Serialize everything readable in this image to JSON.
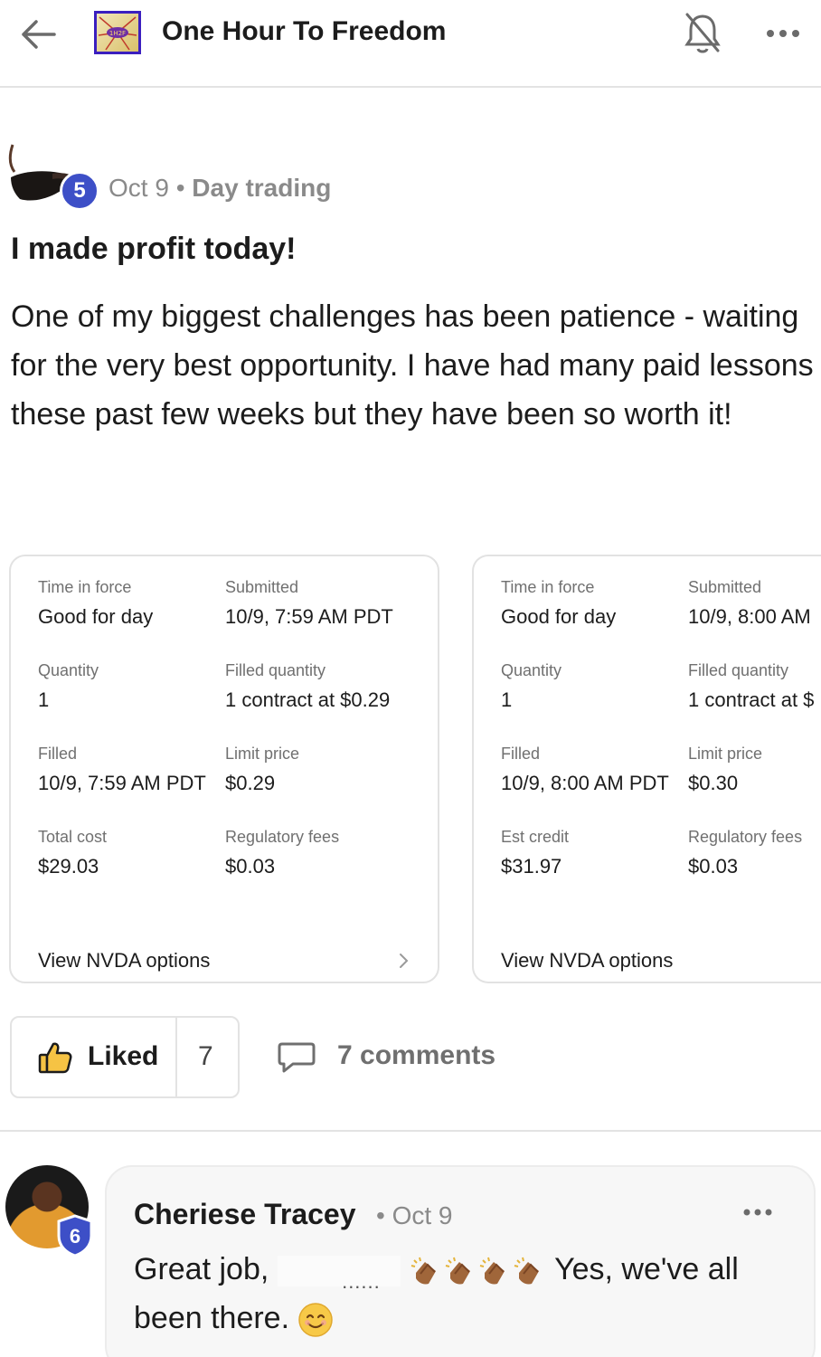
{
  "header": {
    "title": "One Hour To Freedom",
    "logo_text": "1H2F"
  },
  "post": {
    "author_level": "5",
    "date": "Oct 9",
    "separator": "•",
    "category": "Day trading",
    "title": "I made profit today!",
    "body": "One of my biggest challenges has been patience - waiting for the very best opportunity. I have had many paid lessons these past few weeks but they have been so worth it!"
  },
  "orders": [
    {
      "fields": [
        {
          "label": "Time in force",
          "value": "Good for day"
        },
        {
          "label": "Submitted",
          "value": "10/9, 7:59 AM PDT"
        },
        {
          "label": "Quantity",
          "value": "1"
        },
        {
          "label": "Filled quantity",
          "value": "1 contract at $0.29"
        },
        {
          "label": "Filled",
          "value": "10/9, 7:59 AM PDT"
        },
        {
          "label": "Limit price",
          "value": "$0.29"
        },
        {
          "label": "Total cost",
          "value": "$29.03"
        },
        {
          "label": "Regulatory fees",
          "value": "$0.03"
        }
      ],
      "link": "View NVDA options"
    },
    {
      "fields": [
        {
          "label": "Time in force",
          "value": "Good for day"
        },
        {
          "label": "Submitted",
          "value": "10/9, 8:00 AM"
        },
        {
          "label": "Quantity",
          "value": "1"
        },
        {
          "label": "Filled quantity",
          "value": "1 contract at $"
        },
        {
          "label": "Filled",
          "value": "10/9, 8:00 AM PDT"
        },
        {
          "label": "Limit price",
          "value": "$0.30"
        },
        {
          "label": "Est credit",
          "value": "$31.97"
        },
        {
          "label": "Regulatory fees",
          "value": "$0.03"
        }
      ],
      "link": "View NVDA options"
    }
  ],
  "actions": {
    "liked_label": "Liked",
    "like_count": "7",
    "comments_label": "7 comments"
  },
  "comment": {
    "author": "Cheriese Tracey",
    "date": "• Oct 9",
    "author_level": "6",
    "text_before": "Great job,",
    "text_after": "Yes, we've all been there."
  },
  "colors": {
    "level_badge": "#3d4fc7",
    "divider": "#e3e3e3",
    "muted_text": "#8a8a8a"
  },
  "icons": [
    "back-arrow-icon",
    "bell-off-icon",
    "more-icon",
    "chevron-right-icon",
    "thumbs-up-icon",
    "comment-icon",
    "clapping-hands-icon",
    "smile-emoji-icon",
    "shield-icon"
  ]
}
